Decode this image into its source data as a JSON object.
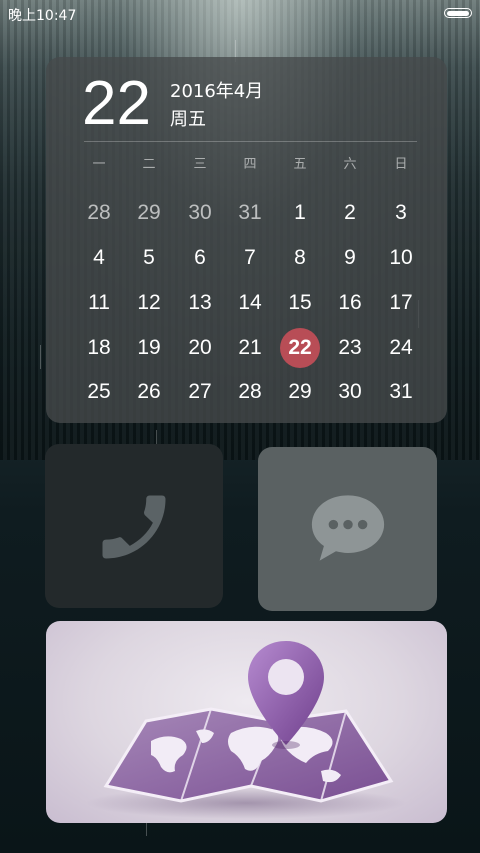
{
  "status_bar": {
    "time": "晚上10:47",
    "battery_icon": "battery-icon"
  },
  "calendar": {
    "day": "22",
    "year_month": "2016年4月",
    "weekday": "周五",
    "weekday_headers": [
      "一",
      "二",
      "三",
      "四",
      "五",
      "六",
      "日"
    ],
    "weeks": [
      [
        "28",
        "29",
        "30",
        "31",
        "1",
        "2",
        "3"
      ],
      [
        "4",
        "5",
        "6",
        "7",
        "8",
        "9",
        "10"
      ],
      [
        "11",
        "12",
        "13",
        "14",
        "15",
        "16",
        "17"
      ],
      [
        "18",
        "19",
        "20",
        "21",
        "22",
        "23",
        "24"
      ],
      [
        "25",
        "26",
        "27",
        "28",
        "29",
        "30",
        "31"
      ]
    ],
    "selected": "22",
    "accent_color": "#b84d56"
  },
  "shortcuts": {
    "phone": {
      "icon": "phone-icon"
    },
    "messages": {
      "icon": "chat-bubble-icon"
    },
    "map": {
      "icon": "map-pin-icon"
    }
  }
}
